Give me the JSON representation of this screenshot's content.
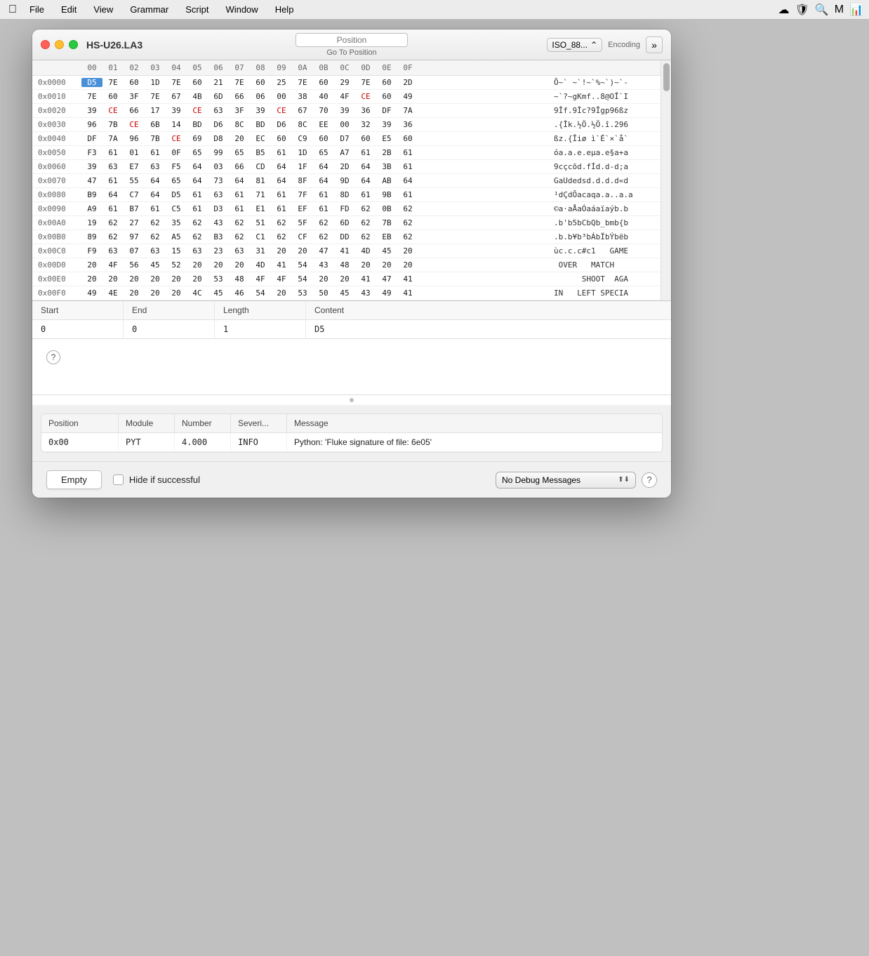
{
  "menubar": {
    "apple": "⌘",
    "items": [
      "File",
      "Edit",
      "View",
      "Grammar",
      "Script",
      "Window",
      "Help"
    ]
  },
  "window": {
    "title": "HS-U26.LA3",
    "position_placeholder": "Position",
    "goto_label": "Go To Position",
    "encoding_value": "ISO_88...",
    "encoding_label": "Encoding"
  },
  "hex": {
    "col_headers": [
      "00",
      "01",
      "02",
      "03",
      "04",
      "05",
      "06",
      "07",
      "08",
      "09",
      "0A",
      "0B",
      "0C",
      "0D",
      "0E",
      "0F"
    ],
    "rows": [
      {
        "addr": "0x0000",
        "bytes": [
          "D5",
          "7E",
          "60",
          "1D",
          "7E",
          "60",
          "21",
          "7E",
          "60",
          "25",
          "7E",
          "60",
          "29",
          "7E",
          "60",
          "2D"
        ],
        "ascii": "Õ~` ~`!~`%~`)~`-",
        "selected": 0
      },
      {
        "addr": "0x0010",
        "bytes": [
          "7E",
          "60",
          "3F",
          "7E",
          "67",
          "4B",
          "6D",
          "66",
          "06",
          "00",
          "38",
          "40",
          "4F",
          "CE",
          "60",
          "49"
        ],
        "ascii": "~`?~gKmf..8@OÎ`I"
      },
      {
        "addr": "0x0020",
        "bytes": [
          "39",
          "CE",
          "66",
          "17",
          "39",
          "CE",
          "63",
          "3F",
          "39",
          "CE",
          "67",
          "70",
          "39",
          "36",
          "DF",
          "7A"
        ],
        "ascii": "9Îf.9Îc?9Îgp96ßz"
      },
      {
        "addr": "0x0030",
        "bytes": [
          "96",
          "7B",
          "CE",
          "6B",
          "14",
          "BD",
          "D6",
          "8C",
          "BD",
          "D6",
          "8C",
          "EE",
          "00",
          "32",
          "39",
          "36"
        ],
        "ascii": ".{Îk.½Ö.½Ö.î.296"
      },
      {
        "addr": "0x0040",
        "bytes": [
          "DF",
          "7A",
          "96",
          "7B",
          "CE",
          "69",
          "D8",
          "20",
          "EC",
          "60",
          "C9",
          "60",
          "D7",
          "60",
          "E5",
          "60"
        ],
        "ascii": "ßz.{Îiø ì`É`×`å`"
      },
      {
        "addr": "0x0050",
        "bytes": [
          "F3",
          "61",
          "01",
          "61",
          "0F",
          "65",
          "99",
          "65",
          "B5",
          "61",
          "1D",
          "65",
          "A7",
          "61",
          "2B",
          "61"
        ],
        "ascii": "óa.a.e.eµa.e§a+a"
      },
      {
        "addr": "0x0060",
        "bytes": [
          "39",
          "63",
          "E7",
          "63",
          "F5",
          "64",
          "03",
          "66",
          "CD",
          "64",
          "1F",
          "64",
          "2D",
          "64",
          "3B",
          "61"
        ],
        "ascii": "9cçcõd.fÍd.d-d;a"
      },
      {
        "addr": "0x0070",
        "bytes": [
          "47",
          "61",
          "55",
          "64",
          "65",
          "64",
          "73",
          "64",
          "81",
          "64",
          "8F",
          "64",
          "9D",
          "64",
          "AB",
          "64"
        ],
        "ascii": "GaUdedsd.d.d.d«d"
      },
      {
        "addr": "0x0080",
        "bytes": [
          "B9",
          "64",
          "C7",
          "64",
          "D5",
          "61",
          "63",
          "61",
          "71",
          "61",
          "7F",
          "61",
          "8D",
          "61",
          "9B",
          "61"
        ],
        "ascii": "¹dÇdÕacaqa.a..a.a"
      },
      {
        "addr": "0x0090",
        "bytes": [
          "A9",
          "61",
          "B7",
          "61",
          "C5",
          "61",
          "D3",
          "61",
          "E1",
          "61",
          "EF",
          "61",
          "FD",
          "62",
          "0B",
          "62"
        ],
        "ascii": "©a·aÅaÓaáaïaýb.b"
      },
      {
        "addr": "0x00A0",
        "bytes": [
          "19",
          "62",
          "27",
          "62",
          "35",
          "62",
          "43",
          "62",
          "51",
          "62",
          "5F",
          "62",
          "6D",
          "62",
          "7B",
          "62"
        ],
        "ascii": ".b'b5bCbQb_bmb{b"
      },
      {
        "addr": "0x00B0",
        "bytes": [
          "89",
          "62",
          "97",
          "62",
          "A5",
          "62",
          "B3",
          "62",
          "C1",
          "62",
          "CF",
          "62",
          "DD",
          "62",
          "EB",
          "62"
        ],
        "ascii": ".b.b¥b³bÁbÏbÝbëb"
      },
      {
        "addr": "0x00C0",
        "bytes": [
          "F9",
          "63",
          "07",
          "63",
          "15",
          "63",
          "23",
          "63",
          "31",
          "20",
          "20",
          "47",
          "41",
          "4D",
          "45",
          "20"
        ],
        "ascii": "ùc.c.c#c1   GAME "
      },
      {
        "addr": "0x00D0",
        "bytes": [
          "20",
          "4F",
          "56",
          "45",
          "52",
          "20",
          "20",
          "20",
          "4D",
          "41",
          "54",
          "43",
          "48",
          "20",
          "20",
          "20"
        ],
        "ascii": " OVER   MATCH   "
      },
      {
        "addr": "0x00E0",
        "bytes": [
          "20",
          "20",
          "20",
          "20",
          "20",
          "20",
          "53",
          "48",
          "4F",
          "4F",
          "54",
          "20",
          "20",
          "41",
          "47",
          "41"
        ],
        "ascii": "      SHOOT  AGA"
      },
      {
        "addr": "0x00F0",
        "bytes": [
          "49",
          "4E",
          "20",
          "20",
          "20",
          "4C",
          "45",
          "46",
          "54",
          "20",
          "53",
          "50",
          "45",
          "43",
          "49",
          "41"
        ],
        "ascii": "IN   LEFT SPECIA"
      }
    ]
  },
  "selection": {
    "start_label": "Start",
    "end_label": "End",
    "length_label": "Length",
    "content_label": "Content",
    "start_val": "0",
    "end_val": "0",
    "length_val": "1",
    "content_val": "D5"
  },
  "messages": {
    "col_position": "Position",
    "col_module": "Module",
    "col_number": "Number",
    "col_severity": "Severi...",
    "col_message": "Message",
    "rows": [
      {
        "position": "0x00",
        "module": "PYT",
        "number": "4.000",
        "severity": "INFO",
        "message": "Python: 'Fluke signature of file: 6e05'"
      }
    ]
  },
  "bottom": {
    "empty_btn": "Empty",
    "hide_label": "Hide if successful",
    "debug_option": "No Debug Messages",
    "help_symbol": "?"
  },
  "edit_label": "— Edit"
}
